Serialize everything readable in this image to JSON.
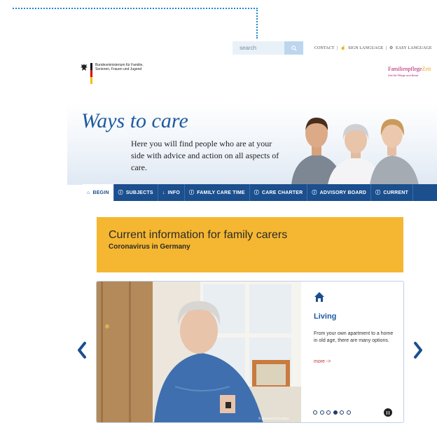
{
  "header": {
    "search_placeholder": "search",
    "utility_links": [
      {
        "label": "CONTACT",
        "sep": "|"
      },
      {
        "label": "SIGN LANGUAGE",
        "sep": "|"
      },
      {
        "label": "EASY LANGUAGE",
        "sep": ""
      }
    ],
    "ministry_name": "Bundesministerium für Familie, Senioren, Frauen und Jugend",
    "partner_logo": {
      "name": "Familienpflege",
      "accent": "Zeit",
      "tagline": "Zeit für Pflege und Beruf"
    }
  },
  "hero": {
    "title": "Ways to care",
    "text": "Here you will find people who are at your side with advice and action on all aspects of care."
  },
  "nav": {
    "items": [
      {
        "label": "BEGIN",
        "icon": "home-icon",
        "active": true
      },
      {
        "label": "SUBJECTS",
        "icon": "info-circle-icon",
        "active": false
      },
      {
        "label": "INFO",
        "icon": "download-icon",
        "active": false
      },
      {
        "label": "FAMILY CARE TIME",
        "icon": "info-circle-icon",
        "active": false
      },
      {
        "label": "CARE CHARTER",
        "icon": "info-circle-icon",
        "active": false
      },
      {
        "label": "ADVISORY BOARD",
        "icon": "info-circle-icon",
        "active": false
      },
      {
        "label": "CURRENT",
        "icon": "info-circle-icon",
        "active": false
      }
    ]
  },
  "banner": {
    "heading": "Current information for family carers",
    "subheading": "Coronavirus in Germany"
  },
  "slider": {
    "icon": "home-icon",
    "title": "Living",
    "text": "From your own apartment to a home in old age, there are many options.",
    "more_label": "more ->",
    "photo_credit": "© plainpicture/Cultura",
    "slide_count": 6,
    "active_slide": 4
  },
  "colors": {
    "brand_blue": "#1b4f8e",
    "banner_yellow": "#f5b731",
    "link_red": "#c0392b"
  }
}
